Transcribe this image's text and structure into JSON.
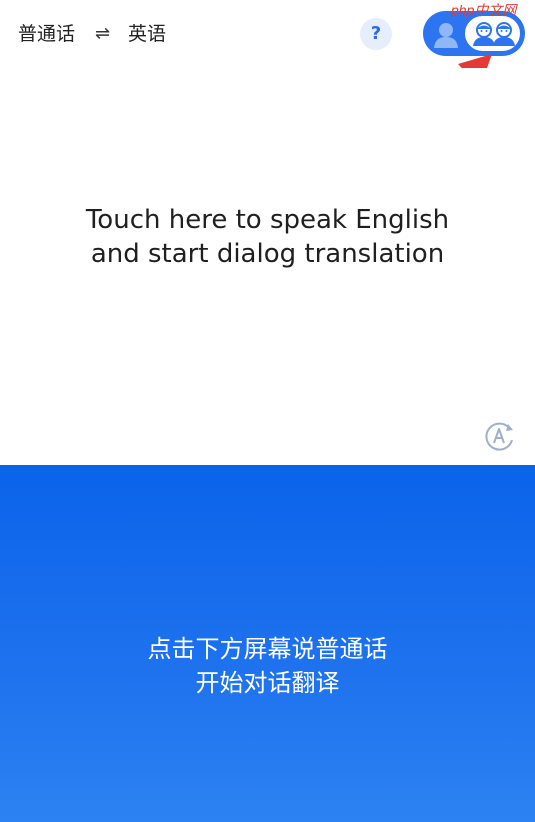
{
  "header": {
    "source_lang": "普通话",
    "swap_symbol": "⇌",
    "target_lang": "英语",
    "help_label": "?",
    "watermark": "php中文网"
  },
  "mode_toggle": {
    "single_icon": "person-icon",
    "dialog_icon": "two-people-icon",
    "active": "dialog"
  },
  "upper_panel": {
    "prompt_line1": "Touch here to speak English",
    "prompt_line2": "and start dialog translation",
    "auto_icon": "auto-translate-icon"
  },
  "lower_panel": {
    "prompt_line1": "点击下方屏幕说普通话",
    "prompt_line2": "开始对话翻译"
  },
  "colors": {
    "accent": "#2d74f0",
    "panel_blue": "#0b63ea",
    "annotation_arrow": "#e53935"
  }
}
